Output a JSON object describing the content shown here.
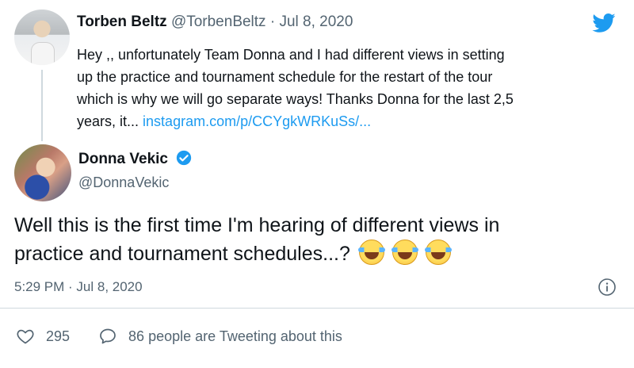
{
  "reply_to": {
    "author_name": "Torben Beltz",
    "author_handle": "@TorbenBeltz",
    "separator": "·",
    "date": "Jul 8, 2020",
    "body_line1": "Hey ,, unfortunately Team Donna and I had different views in setting",
    "body_line2": "up the practice and tournament schedule for the restart of the tour",
    "body_line3": "which is why we will go separate ways! Thanks Donna for the last 2,5",
    "body_line4_text": "years, it...",
    "body_link": "instagram.com/p/CCYgkWRKuSs/..."
  },
  "tweet": {
    "author_name": "Donna Vekic",
    "author_handle": "@DonnaVekic",
    "verified": true,
    "text_line1": "Well this is the first time I'm hearing of different views in",
    "text_line2": "practice and tournament schedules...?",
    "emoji": [
      "face-with-tears-of-joy",
      "face-with-tears-of-joy",
      "face-with-tears-of-joy"
    ],
    "timestamp": "5:29 PM · Jul 8, 2020"
  },
  "actions": {
    "likes": "295",
    "tweeting_text": "86 people are Tweeting about this"
  },
  "colors": {
    "accent": "#1d9bf0",
    "muted": "#536471",
    "text": "#0f1419",
    "divider": "#cfd9de"
  },
  "icons": [
    "twitter-bird-icon",
    "verified-badge-icon",
    "info-icon",
    "heart-icon",
    "speech-bubble-icon"
  ]
}
